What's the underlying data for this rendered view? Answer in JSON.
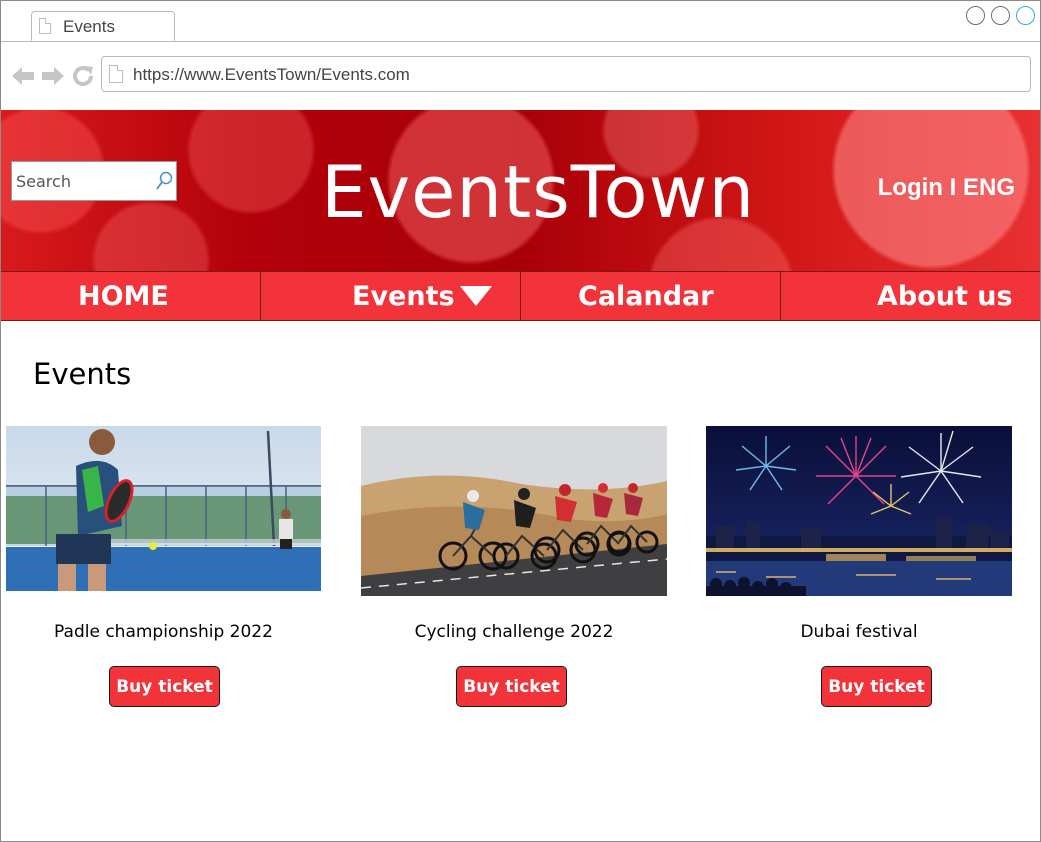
{
  "browser": {
    "tab_title": "Events",
    "url": "https://www.EventsTown/Events.com"
  },
  "header": {
    "search_placeholder": "Search",
    "brand": "EventsTown",
    "login": "Login",
    "separator": "I",
    "language": "ENG"
  },
  "nav": {
    "home": "HOME",
    "events": "Events",
    "calendar": "Calandar",
    "about": "About us"
  },
  "main": {
    "title": "Events",
    "cards": [
      {
        "title": "Padle championship 2022",
        "button": "Buy ticket",
        "image": "padel-player-photo"
      },
      {
        "title": "Cycling challenge 2022",
        "button": "Buy ticket",
        "image": "cyclists-desert-road-photo"
      },
      {
        "title": "Dubai festival",
        "button": "Buy ticket",
        "image": "fireworks-over-marina-photo"
      }
    ]
  },
  "colors": {
    "accent_red": "#f2333a",
    "banner_red": "#b10009",
    "window_control_active": "#3ea6d8"
  },
  "icons": [
    "page-icon",
    "back-arrow-icon",
    "forward-arrow-icon",
    "reload-icon",
    "search-icon",
    "dropdown-triangle-icon"
  ]
}
